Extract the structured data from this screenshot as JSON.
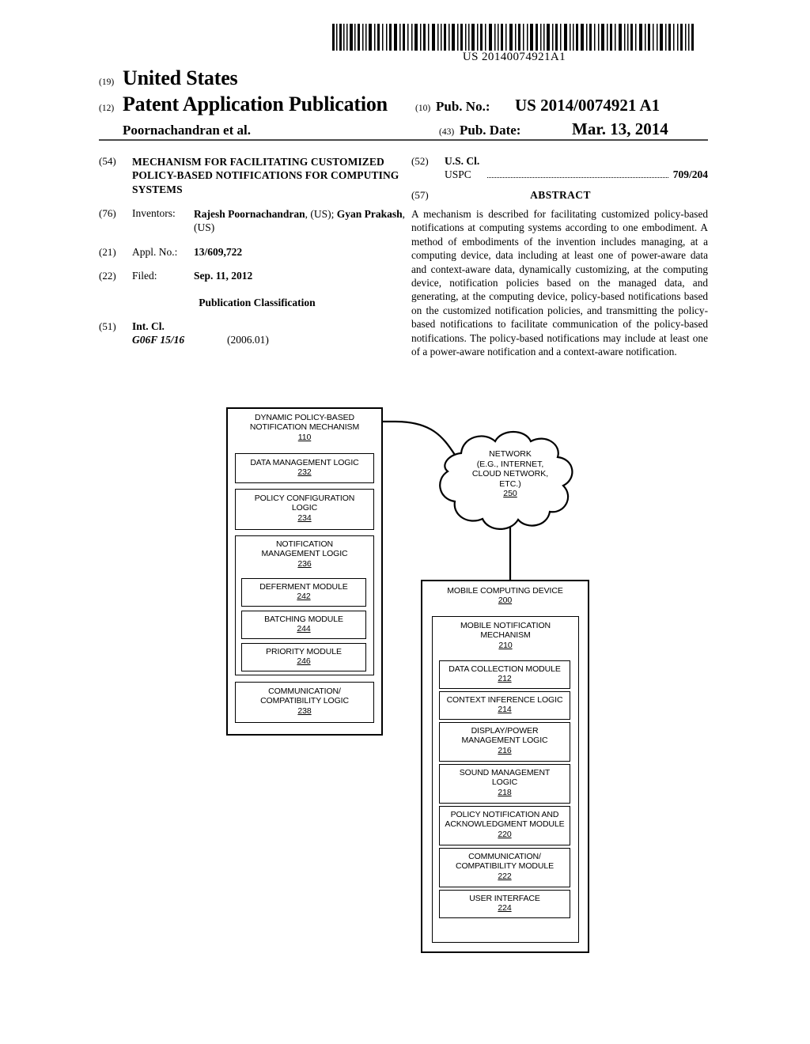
{
  "header": {
    "barcode_text": "US 20140074921A1",
    "country_code": "(19)",
    "country": "United States",
    "doc_type_code": "(12)",
    "doc_type": "Patent Application Publication",
    "author": "Poornachandran et al.",
    "pub_no_code": "(10)",
    "pub_no_label": "Pub. No.:",
    "pub_no_value": "US 2014/0074921 A1",
    "pub_date_code": "(43)",
    "pub_date_label": "Pub. Date:",
    "pub_date_value": "Mar. 13, 2014"
  },
  "biblio": {
    "title_code": "(54)",
    "title": "MECHANISM FOR FACILITATING CUSTOMIZED POLICY-BASED NOTIFICATIONS FOR COMPUTING SYSTEMS",
    "inventors_code": "(76)",
    "inventors_label": "Inventors:",
    "inventor_1_name": "Rajesh Poornachandran",
    "inventor_1_country": ", (US); ",
    "inventor_2_name": "Gyan Prakash",
    "inventor_2_country": ", (US)",
    "appl_no_code": "(21)",
    "appl_no_label": "Appl. No.:",
    "appl_no_value": "13/609,722",
    "filed_code": "(22)",
    "filed_label": "Filed:",
    "filed_value": "Sep. 11, 2012",
    "pub_class_heading": "Publication Classification",
    "int_cl_code": "(51)",
    "int_cl_label": "Int. Cl.",
    "int_cl_value": "G06F 15/16",
    "int_cl_date": "(2006.01)"
  },
  "right_column": {
    "us_cl_code": "(52)",
    "us_cl_label": "U.S. Cl.",
    "uspc_label": "USPC",
    "uspc_value": "709/204",
    "abstract_code": "(57)",
    "abstract_title": "ABSTRACT",
    "abstract_text": "A mechanism is described for facilitating customized policy-based notifications at computing systems according to one embodiment. A method of embodiments of the invention includes managing, at a computing device, data including at least one of power-aware data and context-aware data, dynamically customizing, at the computing device, notification policies based on the managed data, and generating, at the computing device, policy-based notifications based on the customized notification policies, and transmitting the policy-based notifications to facilitate communication of the policy-based notifications. The policy-based notifications may include at least one of a power-aware notification and a context-aware notification."
  },
  "figure": {
    "server": {
      "title_line_1": "DYNAMIC POLICY-BASED",
      "title_line_2": "NOTIFICATION MECHANISM",
      "ref": "110",
      "data_management": {
        "label": "DATA MANAGEMENT LOGIC",
        "ref": "232"
      },
      "policy_config": {
        "label_line_1": "POLICY CONFIGURATION",
        "label_line_2": "LOGIC",
        "ref": "234"
      },
      "notification_mgmt": {
        "label_line_1": "NOTIFICATION",
        "label_line_2": "MANAGEMENT LOGIC",
        "ref": "236",
        "deferment": {
          "label": "DEFERMENT MODULE",
          "ref": "242"
        },
        "batching": {
          "label": "BATCHING MODULE",
          "ref": "244"
        },
        "priority": {
          "label": "PRIORITY MODULE",
          "ref": "246"
        }
      },
      "comm_compat": {
        "label_line_1": "COMMUNICATION/",
        "label_line_2": "COMPATIBILITY LOGIC",
        "ref": "238"
      }
    },
    "network": {
      "line_1": "NETWORK",
      "line_2": "(E.G., INTERNET,",
      "line_3": "CLOUD NETWORK,",
      "line_4": "ETC.)",
      "ref": "250"
    },
    "device": {
      "title": "MOBILE COMPUTING DEVICE",
      "ref": "200",
      "mechanism": {
        "title_line_1": "MOBILE NOTIFICATION",
        "title_line_2": "MECHANISM",
        "ref": "210",
        "data_collection": {
          "label": "DATA COLLECTION MODULE",
          "ref": "212"
        },
        "context_inference": {
          "label": "CONTEXT INFERENCE LOGIC",
          "ref": "214"
        },
        "display_power": {
          "label_line_1": "DISPLAY/POWER",
          "label_line_2": "MANAGEMENT LOGIC",
          "ref": "216"
        },
        "sound_mgmt": {
          "label_line_1": "SOUND MANAGEMENT",
          "label_line_2": "LOGIC",
          "ref": "218"
        },
        "policy_notification": {
          "label_line_1": "POLICY NOTIFICATION AND",
          "label_line_2": "ACKNOWLEDGMENT MODULE",
          "ref": "220"
        },
        "comm_compat": {
          "label_line_1": "COMMUNICATION/",
          "label_line_2": "COMPATIBILITY MODULE",
          "ref": "222"
        },
        "user_interface": {
          "label": "USER INTERFACE",
          "ref": "224"
        }
      }
    }
  }
}
